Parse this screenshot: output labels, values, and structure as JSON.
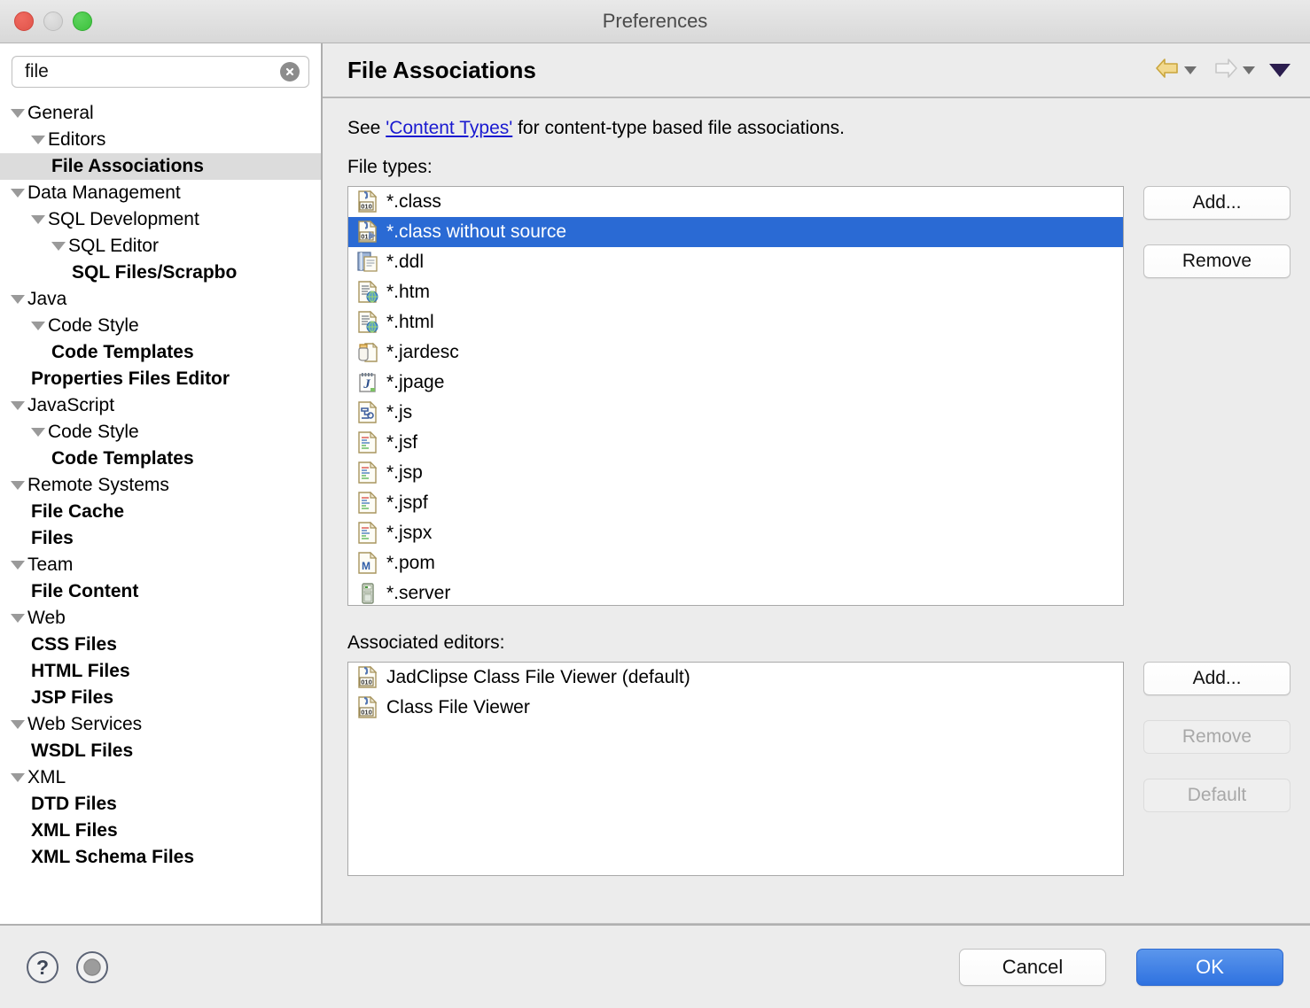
{
  "window": {
    "title": "Preferences",
    "traffic_lights": [
      "close",
      "minimize",
      "zoom"
    ]
  },
  "sidebar": {
    "search": {
      "value": "file",
      "placeholder": "type filter text",
      "clear_icon": "clear-circle-icon"
    },
    "tree": [
      {
        "label": "General",
        "indent": 0,
        "expandable": true,
        "bold": false,
        "selected": false
      },
      {
        "label": "Editors",
        "indent": 1,
        "expandable": true,
        "bold": false,
        "selected": false
      },
      {
        "label": "File Associations",
        "indent": 2,
        "expandable": false,
        "bold": true,
        "selected": true
      },
      {
        "label": "Data Management",
        "indent": 0,
        "expandable": true,
        "bold": false,
        "selected": false
      },
      {
        "label": "SQL Development",
        "indent": 1,
        "expandable": true,
        "bold": false,
        "selected": false
      },
      {
        "label": "SQL Editor",
        "indent": 2,
        "expandable": true,
        "bold": false,
        "selected": false
      },
      {
        "label": "SQL Files/Scrapbo",
        "indent": 3,
        "expandable": false,
        "bold": true,
        "selected": false
      },
      {
        "label": "Java",
        "indent": 0,
        "expandable": true,
        "bold": false,
        "selected": false
      },
      {
        "label": "Code Style",
        "indent": 1,
        "expandable": true,
        "bold": false,
        "selected": false
      },
      {
        "label": "Code Templates",
        "indent": 2,
        "expandable": false,
        "bold": true,
        "selected": false
      },
      {
        "label": "Properties Files Editor",
        "indent": 1,
        "expandable": false,
        "bold": true,
        "selected": false
      },
      {
        "label": "JavaScript",
        "indent": 0,
        "expandable": true,
        "bold": false,
        "selected": false
      },
      {
        "label": "Code Style",
        "indent": 1,
        "expandable": true,
        "bold": false,
        "selected": false
      },
      {
        "label": "Code Templates",
        "indent": 2,
        "expandable": false,
        "bold": true,
        "selected": false
      },
      {
        "label": "Remote Systems",
        "indent": 0,
        "expandable": true,
        "bold": false,
        "selected": false
      },
      {
        "label": "File Cache",
        "indent": 1,
        "expandable": false,
        "bold": true,
        "selected": false
      },
      {
        "label": "Files",
        "indent": 1,
        "expandable": false,
        "bold": true,
        "selected": false
      },
      {
        "label": "Team",
        "indent": 0,
        "expandable": true,
        "bold": false,
        "selected": false
      },
      {
        "label": "File Content",
        "indent": 1,
        "expandable": false,
        "bold": true,
        "selected": false
      },
      {
        "label": "Web",
        "indent": 0,
        "expandable": true,
        "bold": false,
        "selected": false
      },
      {
        "label": "CSS Files",
        "indent": 1,
        "expandable": false,
        "bold": true,
        "selected": false
      },
      {
        "label": "HTML Files",
        "indent": 1,
        "expandable": false,
        "bold": true,
        "selected": false
      },
      {
        "label": "JSP Files",
        "indent": 1,
        "expandable": false,
        "bold": true,
        "selected": false
      },
      {
        "label": "Web Services",
        "indent": 0,
        "expandable": true,
        "bold": false,
        "selected": false
      },
      {
        "label": "WSDL Files",
        "indent": 1,
        "expandable": false,
        "bold": true,
        "selected": false
      },
      {
        "label": "XML",
        "indent": 0,
        "expandable": true,
        "bold": false,
        "selected": false
      },
      {
        "label": "DTD Files",
        "indent": 1,
        "expandable": false,
        "bold": true,
        "selected": false
      },
      {
        "label": "XML Files",
        "indent": 1,
        "expandable": false,
        "bold": true,
        "selected": false
      },
      {
        "label": "XML Schema Files",
        "indent": 1,
        "expandable": false,
        "bold": true,
        "selected": false
      }
    ]
  },
  "panel": {
    "title": "File Associations",
    "nav": {
      "back_icon": "back-arrow-icon",
      "back_menu_icon": "chevron-down-icon",
      "forward_icon": "forward-arrow-icon",
      "forward_menu_icon": "chevron-down-icon",
      "menu_icon": "view-menu-icon"
    },
    "description": {
      "prefix": "See ",
      "link": "'Content Types'",
      "suffix": " for content-type based file associations."
    },
    "file_types_label": "File types:",
    "file_types": [
      {
        "name": "*.class",
        "icon": "class-file-icon",
        "selected": false
      },
      {
        "name": "*.class without source",
        "icon": "class-no-source-icon",
        "selected": true
      },
      {
        "name": "*.ddl",
        "icon": "ddl-file-icon",
        "selected": false
      },
      {
        "name": "*.htm",
        "icon": "html-file-icon",
        "selected": false
      },
      {
        "name": "*.html",
        "icon": "html-file-icon",
        "selected": false
      },
      {
        "name": "*.jardesc",
        "icon": "jardesc-file-icon",
        "selected": false
      },
      {
        "name": "*.jpage",
        "icon": "jpage-file-icon",
        "selected": false
      },
      {
        "name": "*.js",
        "icon": "js-file-icon",
        "selected": false
      },
      {
        "name": "*.jsf",
        "icon": "jsp-file-icon",
        "selected": false
      },
      {
        "name": "*.jsp",
        "icon": "jsp-file-icon",
        "selected": false
      },
      {
        "name": "*.jspf",
        "icon": "jsp-file-icon",
        "selected": false
      },
      {
        "name": "*.jspx",
        "icon": "jsp-file-icon",
        "selected": false
      },
      {
        "name": "*.pom",
        "icon": "pom-file-icon",
        "selected": false
      },
      {
        "name": "*.server",
        "icon": "server-file-icon",
        "selected": false
      }
    ],
    "file_types_buttons": {
      "add": "Add...",
      "remove": "Remove"
    },
    "associated_editors_label": "Associated editors:",
    "associated_editors": [
      {
        "name": "JadClipse Class File Viewer (default)",
        "icon": "class-file-icon"
      },
      {
        "name": "Class File Viewer",
        "icon": "class-file-icon"
      }
    ],
    "editor_buttons": {
      "add": "Add...",
      "remove": "Remove",
      "default": "Default"
    }
  },
  "footer": {
    "help_icon": "help-question-icon",
    "options_icon": "options-circle-icon",
    "cancel": "Cancel",
    "ok": "OK"
  },
  "colors": {
    "selection_blue": "#2a6ad4",
    "ok_button_blue": "#3f81e6",
    "link_blue": "#1a1ad0",
    "tree_selected_gray": "#dcdcdc",
    "panel_bg": "#ececec"
  }
}
